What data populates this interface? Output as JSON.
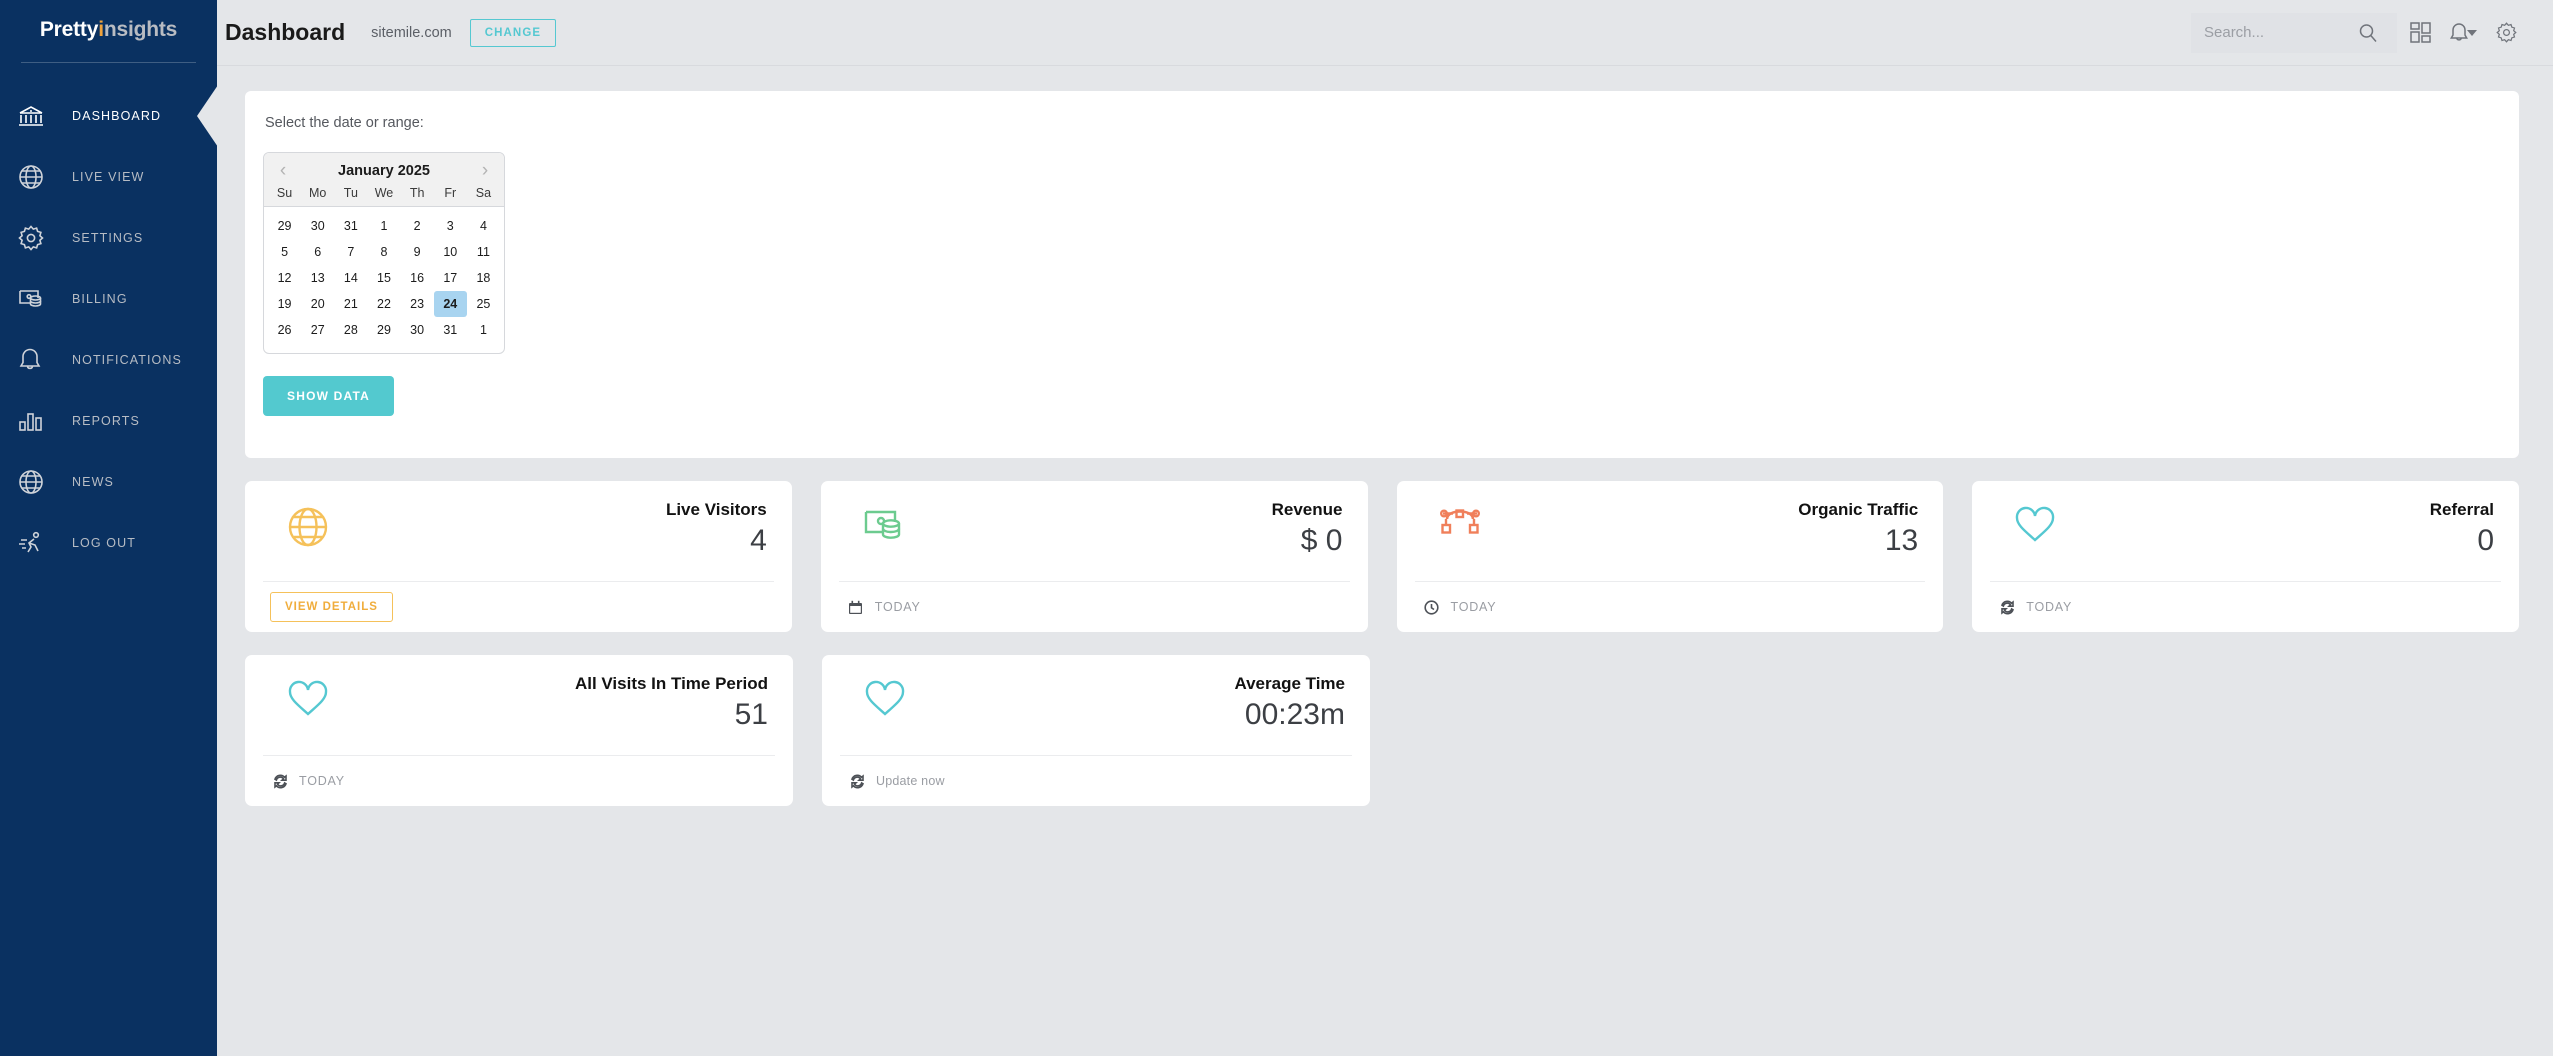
{
  "brand": {
    "name_part1": "Pretty",
    "name_i": "i",
    "name_part2": "nsights",
    "accent_color": "#f0a33c",
    "sidebar_color": "#0a3161"
  },
  "sidebar": {
    "items": [
      {
        "label": "DASHBOARD",
        "icon": "bank-icon",
        "active": true
      },
      {
        "label": "LIVE VIEW",
        "icon": "globe-icon",
        "active": false
      },
      {
        "label": "SETTINGS",
        "icon": "gear-icon",
        "active": false
      },
      {
        "label": "BILLING",
        "icon": "billing-icon",
        "active": false
      },
      {
        "label": "NOTIFICATIONS",
        "icon": "bell-icon",
        "active": false
      },
      {
        "label": "REPORTS",
        "icon": "bar-chart-icon",
        "active": false
      },
      {
        "label": "NEWS",
        "icon": "globe-icon",
        "active": false
      },
      {
        "label": "LOG OUT",
        "icon": "running-person-icon",
        "active": false
      }
    ]
  },
  "header": {
    "title": "Dashboard",
    "domain": "sitemile.com",
    "change_label": "CHANGE",
    "change_color": "#55c8d1",
    "search_placeholder": "Search...",
    "search_value": "",
    "icons": [
      "search-icon",
      "grid-layout-icon",
      "bell-icon",
      "chevron-down-icon",
      "gear-icon"
    ]
  },
  "date_panel": {
    "label": "Select the date or range:",
    "show_data_label": "SHOW DATA",
    "show_data_color": "#53c9cf",
    "calendar": {
      "month_title": "January 2025",
      "prev_label": "‹",
      "next_label": "›",
      "day_headers": [
        "Su",
        "Mo",
        "Tu",
        "We",
        "Th",
        "Fr",
        "Sa"
      ],
      "selected_day": "24",
      "weeks": [
        [
          "29",
          "30",
          "31",
          "1",
          "2",
          "3",
          "4"
        ],
        [
          "5",
          "6",
          "7",
          "8",
          "9",
          "10",
          "11"
        ],
        [
          "12",
          "13",
          "14",
          "15",
          "16",
          "17",
          "18"
        ],
        [
          "19",
          "20",
          "21",
          "22",
          "23",
          "24",
          "25"
        ],
        [
          "26",
          "27",
          "28",
          "29",
          "30",
          "31",
          "1"
        ]
      ]
    }
  },
  "cards_row1": [
    {
      "title": "Live Visitors",
      "value": "4",
      "icon": "globe-icon",
      "icon_color": "#f5c15a",
      "footer_type": "button",
      "footer_label": "VIEW DETAILS"
    },
    {
      "title": "Revenue",
      "value": "$ 0",
      "icon": "money-cash-icon",
      "icon_color": "#6ccb8f",
      "footer_type": "text",
      "footer_icon": "calendar-icon",
      "footer_label": "TODAY"
    },
    {
      "title": "Organic Traffic",
      "value": "13",
      "icon": "bezier-curve-icon",
      "icon_color": "#f07f5a",
      "footer_type": "text",
      "footer_icon": "clock-icon",
      "footer_label": "TODAY"
    },
    {
      "title": "Referral",
      "value": "0",
      "icon": "heart-icon",
      "icon_color": "#55c8d1",
      "footer_type": "text",
      "footer_icon": "refresh-icon",
      "footer_label": "TODAY"
    }
  ],
  "cards_row2": [
    {
      "title": "All Visits In Time Period",
      "value": "51",
      "icon": "heart-icon",
      "icon_color": "#55c8d1",
      "footer_type": "text",
      "footer_icon": "refresh-icon",
      "footer_label": "TODAY"
    },
    {
      "title": "Average Time",
      "value": "00:23m",
      "icon": "heart-icon",
      "icon_color": "#55c8d1",
      "footer_type": "text",
      "footer_icon": "refresh-icon",
      "footer_label": "Update now"
    }
  ]
}
